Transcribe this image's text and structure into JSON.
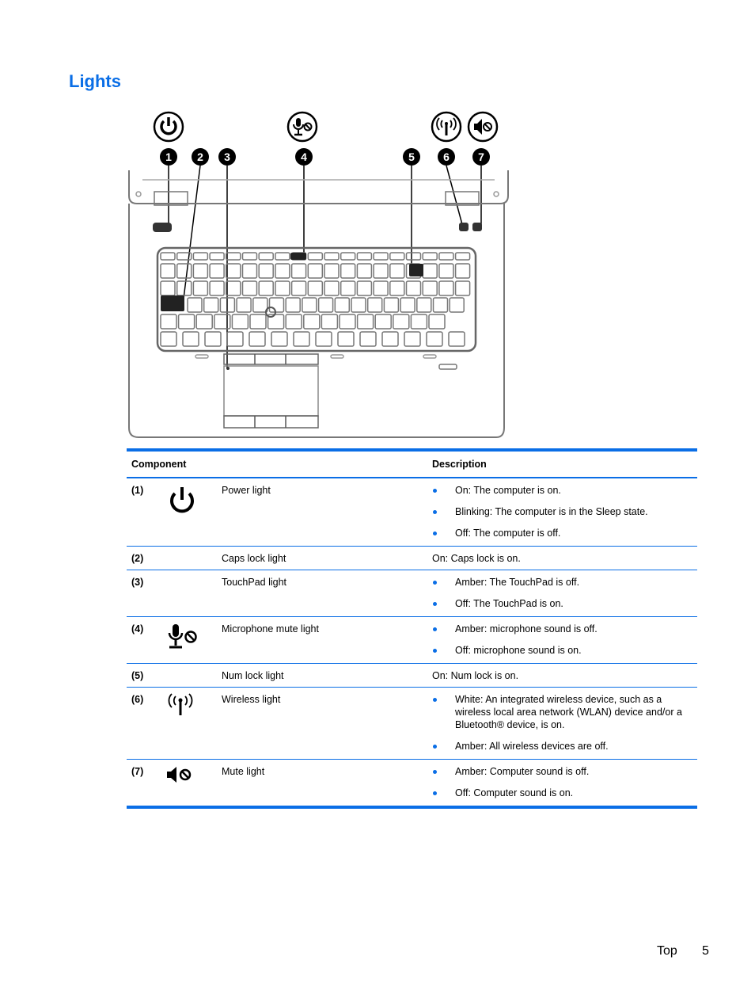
{
  "page": {
    "title": "Lights",
    "footer_section": "Top",
    "footer_page": "5"
  },
  "figure": {
    "callouts": [
      "1",
      "2",
      "3",
      "4",
      "5",
      "6",
      "7"
    ],
    "callout_icons": [
      "power-icon",
      "microphone-mute-icon",
      "wireless-icon",
      "mute-icon"
    ]
  },
  "table": {
    "headers": {
      "component": "Component",
      "description": "Description"
    },
    "rows": [
      {
        "num": "(1)",
        "icon": "power",
        "name": "Power light",
        "desc_type": "list",
        "desc": [
          "On: The computer is on.",
          "Blinking: The computer is in the Sleep state.",
          "Off: The computer is off."
        ]
      },
      {
        "num": "(2)",
        "icon": "",
        "name": "Caps lock light",
        "desc_type": "text",
        "desc": [
          "On: Caps lock is on."
        ]
      },
      {
        "num": "(3)",
        "icon": "",
        "name": "TouchPad light",
        "desc_type": "list",
        "desc": [
          "Amber: The TouchPad is off.",
          "Off: The TouchPad is on."
        ]
      },
      {
        "num": "(4)",
        "icon": "mic-mute",
        "name": "Microphone mute light",
        "desc_type": "list",
        "desc": [
          "Amber: microphone sound is off.",
          "Off: microphone sound is on."
        ]
      },
      {
        "num": "(5)",
        "icon": "",
        "name": "Num lock light",
        "desc_type": "text",
        "desc": [
          "On: Num lock is on."
        ]
      },
      {
        "num": "(6)",
        "icon": "wireless",
        "name": "Wireless light",
        "desc_type": "list",
        "desc": [
          "White: An integrated wireless device, such as a wireless local area network (WLAN) device and/or a Bluetooth® device, is on.",
          "Amber: All wireless devices are off."
        ]
      },
      {
        "num": "(7)",
        "icon": "mute",
        "name": "Mute light",
        "desc_type": "list",
        "desc": [
          "Amber: Computer sound is off.",
          "Off: Computer sound is on."
        ]
      }
    ]
  },
  "colors": {
    "accent": "#0a6ee6"
  }
}
